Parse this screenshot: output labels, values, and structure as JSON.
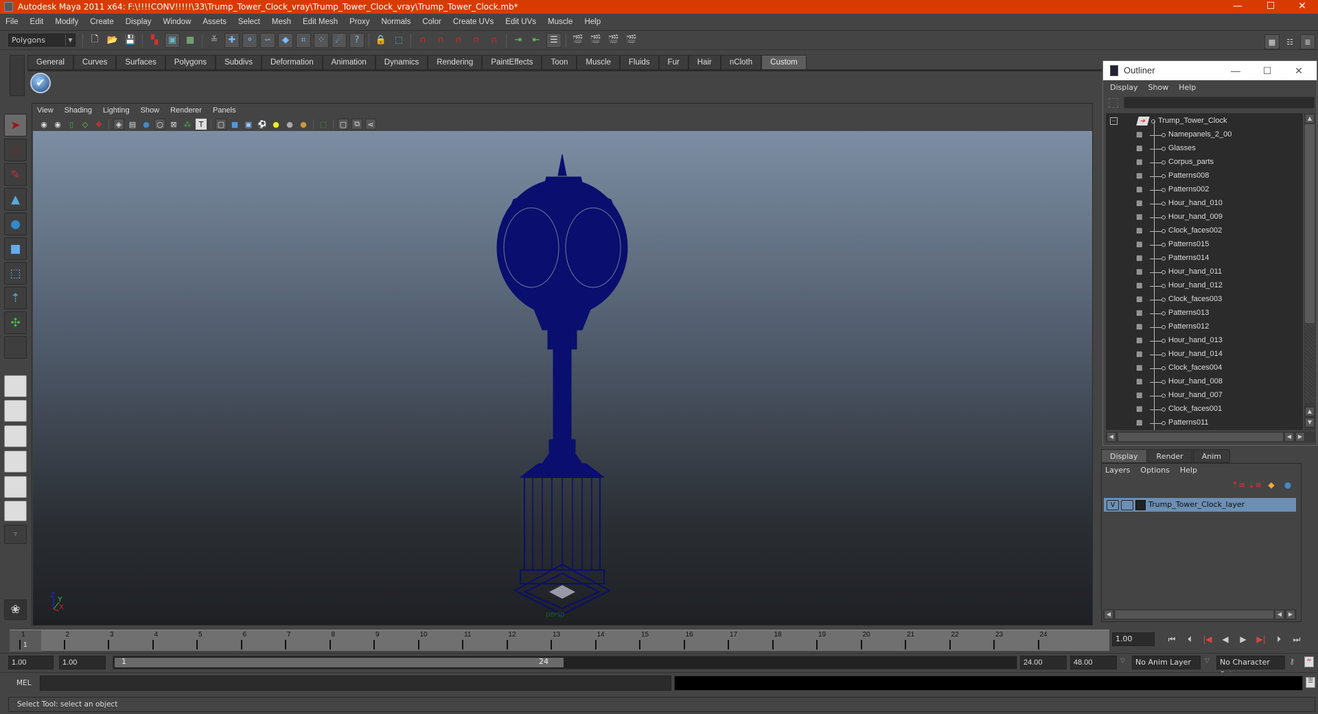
{
  "window": {
    "title": "Autodesk Maya 2011 x64: F:\\!!!!CONV!!!!!\\33\\Trump_Tower_Clock_vray\\Trump_Tower_Clock_vray\\Trump_Tower_Clock.mb*",
    "controls": {
      "minimize": "—",
      "maximize": "☐",
      "close": "✕"
    },
    "title_color": "#d83b01"
  },
  "menubar": [
    "File",
    "Edit",
    "Modify",
    "Create",
    "Display",
    "Window",
    "Assets",
    "Select",
    "Mesh",
    "Edit Mesh",
    "Proxy",
    "Normals",
    "Color",
    "Create UVs",
    "Edit UVs",
    "Muscle",
    "Help"
  ],
  "statusline": {
    "mode": "Polygons",
    "icons": [
      "new-scene",
      "open-scene",
      "save-scene",
      "select-by-hierarchy",
      "select-by-object",
      "select-by-component",
      "mask-menu",
      "select-handle",
      "select-joint",
      "select-curve",
      "select-surface",
      "select-deformer",
      "select-particle",
      "select-dynamics",
      "select-misc",
      "lock-selection",
      "highlight-selection",
      "snap-grid",
      "snap-curve",
      "snap-point",
      "snap-surface",
      "snap-live",
      "input-history",
      "output-history",
      "construction-history",
      "render-view",
      "render-current",
      "ipr-render",
      "render-settings"
    ]
  },
  "shelf": {
    "tabs": [
      "General",
      "Curves",
      "Surfaces",
      "Polygons",
      "Subdivs",
      "Deformation",
      "Animation",
      "Dynamics",
      "Rendering",
      "PaintEffects",
      "Toon",
      "Muscle",
      "Fluids",
      "Fur",
      "Hair",
      "nCloth",
      "Custom"
    ],
    "active_tab": "Custom",
    "items": [
      "checkmark-shelf-icon"
    ]
  },
  "toolbox": {
    "tools": [
      "select-tool",
      "lasso-tool",
      "paint-select-tool",
      "move-tool",
      "rotate-tool",
      "scale-tool",
      "universal-manipulator",
      "soft-mod-tool",
      "show-manipulator",
      "last-tool"
    ],
    "active": "select-tool",
    "layouts": [
      "single-perspective",
      "four-view",
      "outliner-persp",
      "persp-graph",
      "hypershade-persp",
      "persp-graph-hypergraph"
    ]
  },
  "viewport": {
    "menu": [
      "View",
      "Shading",
      "Lighting",
      "Show",
      "Renderer",
      "Panels"
    ],
    "camera_label": "persp",
    "axis": {
      "x": "X",
      "y": "Y",
      "z": "Z"
    },
    "model": "Trump_Tower_Clock",
    "wire_color": "#0a0e6e"
  },
  "timeline": {
    "ticks": [
      "1",
      "2",
      "3",
      "4",
      "5",
      "6",
      "7",
      "8",
      "9",
      "10",
      "11",
      "12",
      "13",
      "14",
      "15",
      "16",
      "17",
      "18",
      "19",
      "20",
      "21",
      "22",
      "23",
      "24"
    ],
    "current_frame_marker": "1",
    "current_frame": "1.00",
    "playback_buttons": [
      "go-to-start",
      "step-back-key",
      "step-back-frame",
      "play-backward",
      "play-forward",
      "step-forward-frame",
      "step-forward-key",
      "go-to-end"
    ]
  },
  "range": {
    "start_time": "1.00",
    "playback_start": "1.00",
    "slider_start": "1",
    "slider_end": "24",
    "playback_end": "24.00",
    "end_time": "48.00",
    "anim_layer": "No Anim Layer",
    "character_set": "No Character Set"
  },
  "commandline": {
    "label": "MEL",
    "value": "",
    "result": ""
  },
  "helpline": "Select Tool: select an object",
  "outliner": {
    "title": "Outliner",
    "menu": [
      "Display",
      "Show",
      "Help"
    ],
    "filter": "",
    "root": "Trump_Tower_Clock",
    "items": [
      "Namepanels_2_00",
      "Glasses",
      "Corpus_parts",
      "Patterns008",
      "Patterns002",
      "Hour_hand_010",
      "Hour_hand_009",
      "Clock_faces002",
      "Patterns015",
      "Patterns014",
      "Hour_hand_011",
      "Hour_hand_012",
      "Clock_faces003",
      "Patterns013",
      "Patterns012",
      "Hour_hand_013",
      "Hour_hand_014",
      "Clock_faces004",
      "Hour_hand_008",
      "Hour_hand_007",
      "Clock_faces001",
      "Patterns011"
    ]
  },
  "layers": {
    "tabs": [
      "Display",
      "Render",
      "Anim"
    ],
    "active_tab": "Display",
    "menu": [
      "Layers",
      "Options",
      "Help"
    ],
    "rows": [
      {
        "visible": "V",
        "name": "Trump_Tower_Clock_layer"
      }
    ],
    "row_color": "#6c8fb3"
  }
}
